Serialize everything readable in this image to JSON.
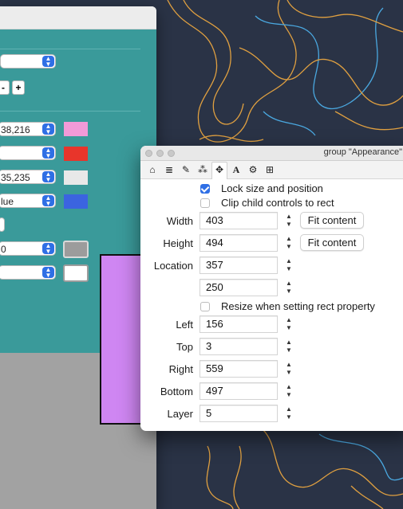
{
  "colors": {
    "teal": "#3a9a9a",
    "accent": "#2f6fe5",
    "swatch_pink": "#f29ad8",
    "swatch_red": "#e8352b",
    "swatch_lightgray": "#e8e8e8",
    "swatch_blue": "#3b64e0",
    "swatch_gray": "#9c9c9c",
    "swatch_white": "#ffffff",
    "canvas_purple": "#cf86f2"
  },
  "back_window": {
    "popups": [
      {
        "value": ""
      },
      {
        "value": "38,216"
      },
      {
        "value": ""
      },
      {
        "value": "35,235"
      },
      {
        "value": "lue"
      },
      {
        "value": "0"
      },
      {
        "value": ""
      }
    ],
    "minus_label": "-",
    "plus_label": "+"
  },
  "inspector": {
    "title": "group \"Appearance\"",
    "toolbar_icons": [
      "home-icon",
      "database-icon",
      "pencil-icon",
      "magic-wand-icon",
      "move-icon",
      "font-icon",
      "gears-icon",
      "layout-icon"
    ],
    "toolbar_glyphs": [
      "⌂",
      "≣",
      "✎",
      "⁂",
      "✥",
      "A",
      "⚙",
      "⊞"
    ],
    "lock_label": "Lock size and position",
    "lock_checked": true,
    "clip_label": "Clip child controls to rect",
    "clip_checked": false,
    "width_label": "Width",
    "width_value": "403",
    "height_label": "Height",
    "height_value": "494",
    "fit_content_label": "Fit content",
    "location_label": "Location",
    "location_x": "357",
    "location_y": "250",
    "resize_label": "Resize when setting rect property",
    "resize_checked": false,
    "left_label": "Left",
    "left_value": "156",
    "top_label": "Top",
    "top_value": "3",
    "right_label": "Right",
    "right_value": "559",
    "bottom_label": "Bottom",
    "bottom_value": "497",
    "layer_label": "Layer",
    "layer_value": "5"
  }
}
